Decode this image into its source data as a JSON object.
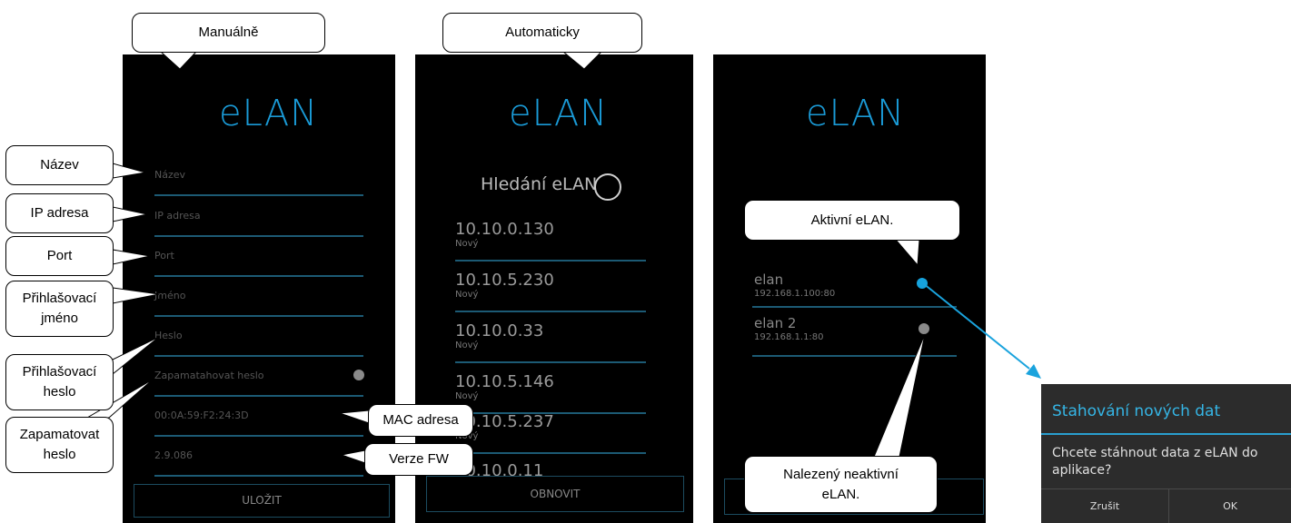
{
  "callouts": {
    "manual": "Manuálně",
    "auto": "Automaticky",
    "nazev": "Název",
    "ip": "IP adresa",
    "port": "Port",
    "login_name_1": "Přihlašovací",
    "login_name_2": "jméno",
    "login_pass_1": "Přihlašovací",
    "login_pass_2": "heslo",
    "remember_1": "Zapamatovat",
    "remember_2": "heslo",
    "mac": "MAC adresa",
    "fw": "Verze FW",
    "active": "Aktivní eLAN.",
    "inactive_1": "Nalezený neaktivní",
    "inactive_2": "eLAN."
  },
  "screen_manual": {
    "logo": "eLAN",
    "fields": {
      "name": "Název",
      "ip": "IP adresa",
      "port": "Port",
      "user": "Jméno",
      "password": "Heslo",
      "remember": "Zapamatahovat heslo",
      "mac_value": "00:0A:59:F2:24:3D",
      "fw_value": "2.9.086"
    },
    "save_label": "ULOŽIT",
    "colors": {
      "accent": "#1a9ad6",
      "line": "#1c5a74"
    }
  },
  "screen_auto": {
    "logo": "eLAN",
    "search_label": "Hledání eLAN",
    "items": [
      {
        "ip": "10.10.0.130",
        "status": "Nový"
      },
      {
        "ip": "10.10.5.230",
        "status": "Nový"
      },
      {
        "ip": "10.10.0.33",
        "status": "Nový"
      },
      {
        "ip": "10.10.5.146",
        "status": "Nový"
      },
      {
        "ip": "10.10.5.237",
        "status": "Nový"
      },
      {
        "ip": "10.10.0.11",
        "status": ""
      }
    ],
    "refresh_label": "OBNOVIT"
  },
  "screen_list": {
    "logo": "eLAN",
    "items": [
      {
        "name": "elan",
        "address": "192.168.1.100:80",
        "status": "active"
      },
      {
        "name": "elan 2",
        "address": "192.168.1.1:80",
        "status": "inactive"
      }
    ],
    "colors": {
      "active": "#16a3dd",
      "inactive": "#8a8a8a"
    }
  },
  "dialog": {
    "title": "Stahování nových dat",
    "message": "Chcete stáhnout data z eLAN do aplikace?",
    "cancel": "Zrušit",
    "ok": "OK"
  }
}
